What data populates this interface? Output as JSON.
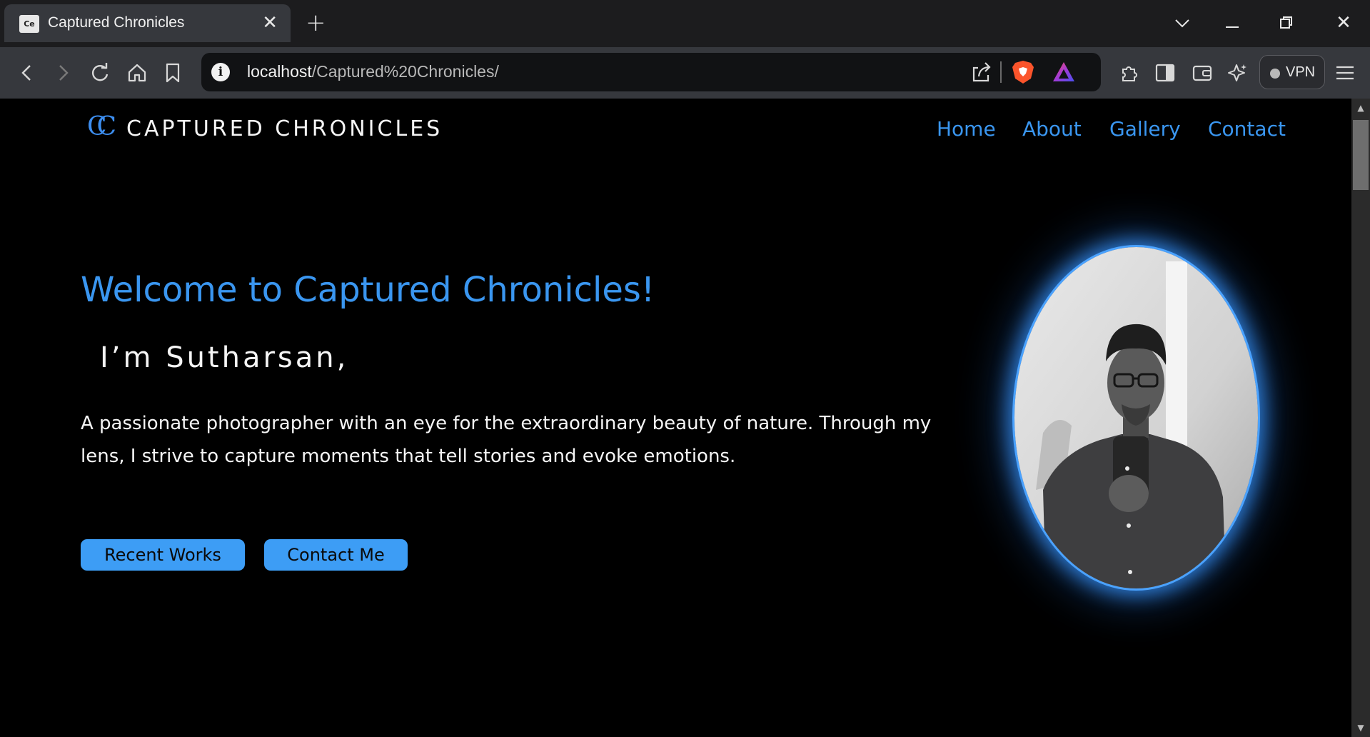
{
  "browser": {
    "tab": {
      "title": "Captured Chronicles",
      "favicon_text": "Ce"
    },
    "address": {
      "host": "localhost",
      "path": "/Captured%20Chronicles/"
    },
    "vpn_label": "VPN",
    "icons": {
      "back": "chevron-left-icon",
      "forward": "chevron-right-icon",
      "reload": "reload-icon",
      "home": "home-icon",
      "bookmark": "bookmark-icon",
      "info": "info-icon",
      "share": "share-icon",
      "brave": "brave-shields-icon",
      "rewards": "brave-rewards-icon",
      "extensions": "puzzle-icon",
      "sidebar": "sidebar-icon",
      "wallet": "wallet-icon",
      "leo": "sparkle-icon",
      "menu": "hamburger-icon"
    }
  },
  "site": {
    "logo_mark": "CC",
    "logo_text": "CAPTURED CHRONICLES",
    "nav": [
      "Home",
      "About",
      "Gallery",
      "Contact"
    ]
  },
  "hero": {
    "title": "Welcome to Captured Chronicles!",
    "name": "I’m Sutharsan,",
    "description": "A passionate photographer with an eye for the extraordinary beauty of nature. Through my lens, I strive to capture moments that tell stories and evoke emotions.",
    "buttons": [
      "Recent Works",
      "Contact Me"
    ]
  },
  "colors": {
    "accent": "#3a96f0",
    "button_bg": "#3d9df5",
    "page_bg": "#000000",
    "glow": "#4aa2ff"
  }
}
